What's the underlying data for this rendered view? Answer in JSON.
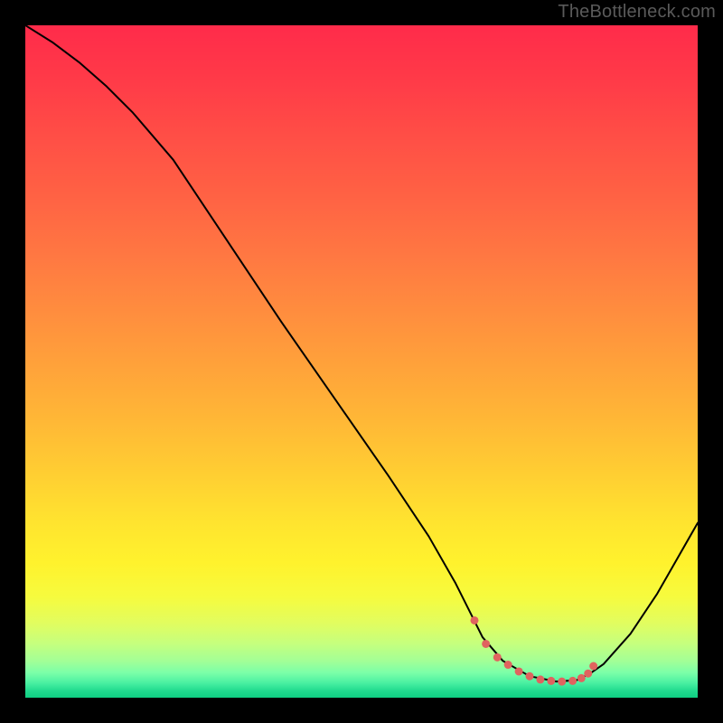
{
  "watermark": {
    "text": "TheBottleneck.com"
  },
  "chart_data": {
    "type": "line",
    "title": "",
    "xlabel": "",
    "ylabel": "",
    "xlim": [
      0,
      100
    ],
    "ylim": [
      0,
      100
    ],
    "grid": false,
    "background_gradient": {
      "stops": [
        {
          "offset": 0.0,
          "color": "#ff2b4a"
        },
        {
          "offset": 0.08,
          "color": "#ff3a48"
        },
        {
          "offset": 0.16,
          "color": "#ff4d46"
        },
        {
          "offset": 0.25,
          "color": "#ff6144"
        },
        {
          "offset": 0.34,
          "color": "#ff7742"
        },
        {
          "offset": 0.43,
          "color": "#ff8e3e"
        },
        {
          "offset": 0.51,
          "color": "#ffa33a"
        },
        {
          "offset": 0.59,
          "color": "#ffb836"
        },
        {
          "offset": 0.67,
          "color": "#ffcf32"
        },
        {
          "offset": 0.74,
          "color": "#ffe42f"
        },
        {
          "offset": 0.8,
          "color": "#fff22d"
        },
        {
          "offset": 0.85,
          "color": "#f6fb3e"
        },
        {
          "offset": 0.89,
          "color": "#e1fd60"
        },
        {
          "offset": 0.92,
          "color": "#c5ff7e"
        },
        {
          "offset": 0.945,
          "color": "#a3ff96"
        },
        {
          "offset": 0.963,
          "color": "#7bffa8"
        },
        {
          "offset": 0.978,
          "color": "#4af0a2"
        },
        {
          "offset": 0.99,
          "color": "#20da8e"
        },
        {
          "offset": 1.0,
          "color": "#0fcf82"
        }
      ]
    },
    "series": [
      {
        "name": "bottleneck-curve",
        "color": "#000000",
        "x": [
          0,
          4,
          8,
          12,
          16,
          22,
          30,
          38,
          46,
          54,
          60,
          64,
          66.5,
          68,
          71,
          75,
          79,
          82,
          84,
          86,
          90,
          94,
          100
        ],
        "y": [
          100,
          97.5,
          94.5,
          91,
          87,
          80,
          68,
          56,
          44.5,
          33,
          24,
          17,
          12,
          9,
          5.5,
          3.2,
          2.4,
          2.6,
          3.6,
          5,
          9.5,
          15.5,
          26
        ]
      },
      {
        "name": "solution-markers",
        "color": "#e0635f",
        "type": "scatter",
        "marker_size": 9,
        "x": [
          66.8,
          68.5,
          70.2,
          71.8,
          73.4,
          75.0,
          76.6,
          78.2,
          79.8,
          81.4,
          82.7,
          83.7,
          84.5
        ],
        "y": [
          11.5,
          8.0,
          6.0,
          4.9,
          3.9,
          3.2,
          2.7,
          2.5,
          2.4,
          2.5,
          2.9,
          3.6,
          4.7
        ]
      }
    ]
  }
}
